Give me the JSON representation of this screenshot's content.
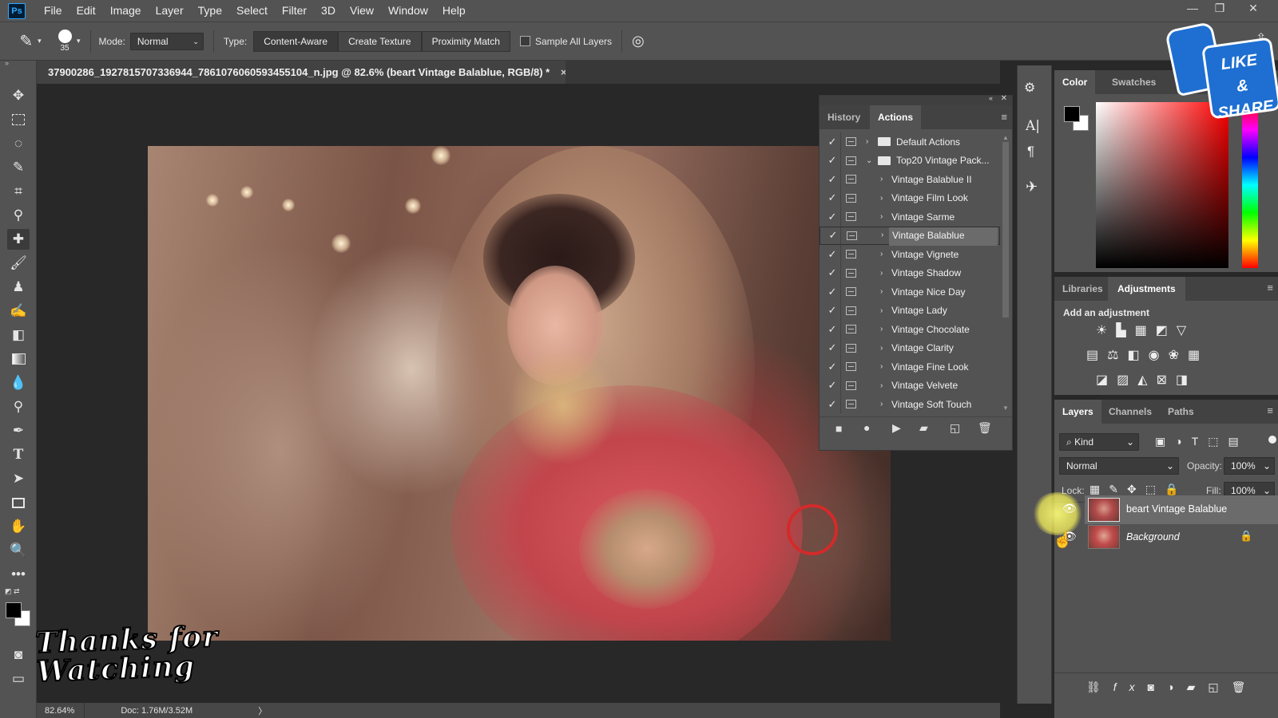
{
  "app": {
    "logo": "Ps",
    "menu": [
      "File",
      "Edit",
      "Image",
      "Layer",
      "Type",
      "Select",
      "Filter",
      "3D",
      "View",
      "Window",
      "Help"
    ]
  },
  "options": {
    "brush_size": "35",
    "mode_label": "Mode:",
    "mode_value": "Normal",
    "type_label": "Type:",
    "type_options": [
      "Content-Aware",
      "Create Texture",
      "Proximity Match"
    ],
    "sample_all_layers": "Sample All Layers"
  },
  "document": {
    "tab_title": "37900286_1927815707336944_7861076060593455104_n.jpg @ 82.6% (beart Vintage Balablue, RGB/8) *",
    "close": "×",
    "zoom": "82.64%",
    "doc_size": "Doc: 1.76M/3.52M",
    "status_arrow": "〉"
  },
  "actions_panel": {
    "tabs": [
      "History",
      "Actions"
    ],
    "active_tab": "Actions",
    "items": [
      {
        "label": "Default Actions",
        "type": "set",
        "expanded": false
      },
      {
        "label": "Top20 Vintage Pack...",
        "type": "set",
        "expanded": true
      },
      {
        "label": "Vintage Balablue II",
        "type": "action"
      },
      {
        "label": "Vintage Film Look",
        "type": "action"
      },
      {
        "label": "Vintage Sarme",
        "type": "action"
      },
      {
        "label": "Vintage Balablue",
        "type": "action",
        "selected": true
      },
      {
        "label": "Vintage Vignete",
        "type": "action"
      },
      {
        "label": "Vintage Shadow",
        "type": "action"
      },
      {
        "label": "Vintage Nice Day",
        "type": "action"
      },
      {
        "label": "Vintage Lady",
        "type": "action"
      },
      {
        "label": "Vintage Chocolate",
        "type": "action"
      },
      {
        "label": "Vintage Clarity",
        "type": "action"
      },
      {
        "label": "Vintage Fine Look",
        "type": "action"
      },
      {
        "label": "Vintage Velvete",
        "type": "action"
      },
      {
        "label": "Vintage Soft Touch",
        "type": "action"
      }
    ]
  },
  "color_panel": {
    "tabs": [
      "Color",
      "Swatches"
    ],
    "active_tab": "Color"
  },
  "adjustments_panel": {
    "tabs": [
      "Libraries",
      "Adjustments"
    ],
    "active_tab": "Adjustments",
    "heading": "Add an adjustment"
  },
  "layers_panel": {
    "tabs": [
      "Layers",
      "Channels",
      "Paths"
    ],
    "active_tab": "Layers",
    "filter_kind": "Kind",
    "blend_mode": "Normal",
    "opacity_label": "Opacity:",
    "opacity_value": "100%",
    "lock_label": "Lock:",
    "fill_label": "Fill:",
    "fill_value": "100%",
    "layers": [
      {
        "name": "beart Vintage Balablue",
        "selected": true
      },
      {
        "name": "Background",
        "locked": true
      }
    ]
  },
  "overlay": {
    "like_share": [
      "LIKE",
      "& SHARE"
    ],
    "thanks": [
      "Thanks for",
      "Watching"
    ]
  },
  "colors": {
    "ui_bg": "#535353",
    "canvas_bg": "#282828",
    "selection": "#6b6b6b",
    "accent": "#31a8ff",
    "ring": "#d42a2a"
  }
}
